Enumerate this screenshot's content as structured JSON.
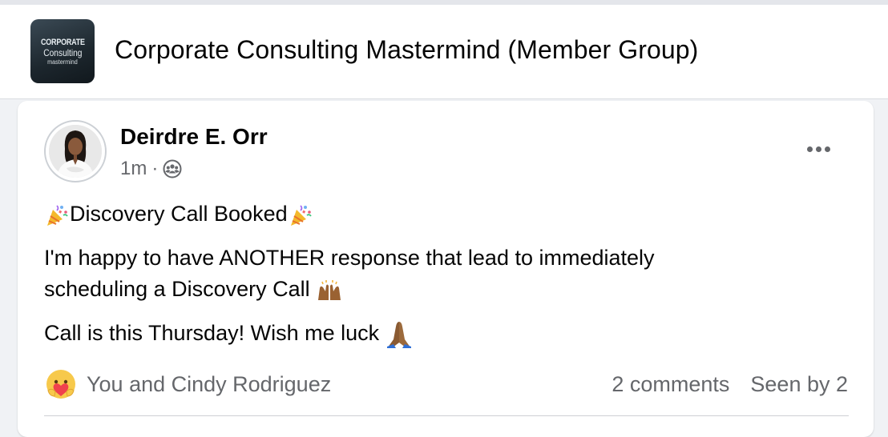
{
  "group": {
    "logo_line1": "CORPORATE",
    "logo_line2": "Consulting",
    "logo_line3": "mastermind",
    "title": "Corporate Consulting Mastermind (Member Group)"
  },
  "post": {
    "author": "Deirdre E. Orr",
    "time": "1m",
    "separator": "·",
    "audience_icon": "members-group-icon",
    "more_icon": "more-options-icon",
    "headline": "Discovery Call Booked",
    "headline_emoji": "party-popper-icon",
    "paragraph1_line1": "I'm happy to have ANOTHER response that lead to immediately",
    "paragraph1_line2": "scheduling a Discovery Call",
    "paragraph1_emoji": "raising-hands-icon",
    "paragraph2": "Call is this Thursday! Wish me luck",
    "paragraph2_emoji": "folded-hands-icon"
  },
  "footer": {
    "reaction_icon": "care-reaction-icon",
    "reactions_text": "You and Cindy Rodriguez",
    "comments": "2 comments",
    "seen_by": "Seen by 2"
  },
  "colors": {
    "background": "#f0f2f5",
    "card": "#ffffff",
    "secondary_text": "#65676b",
    "primary_text": "#050505"
  }
}
